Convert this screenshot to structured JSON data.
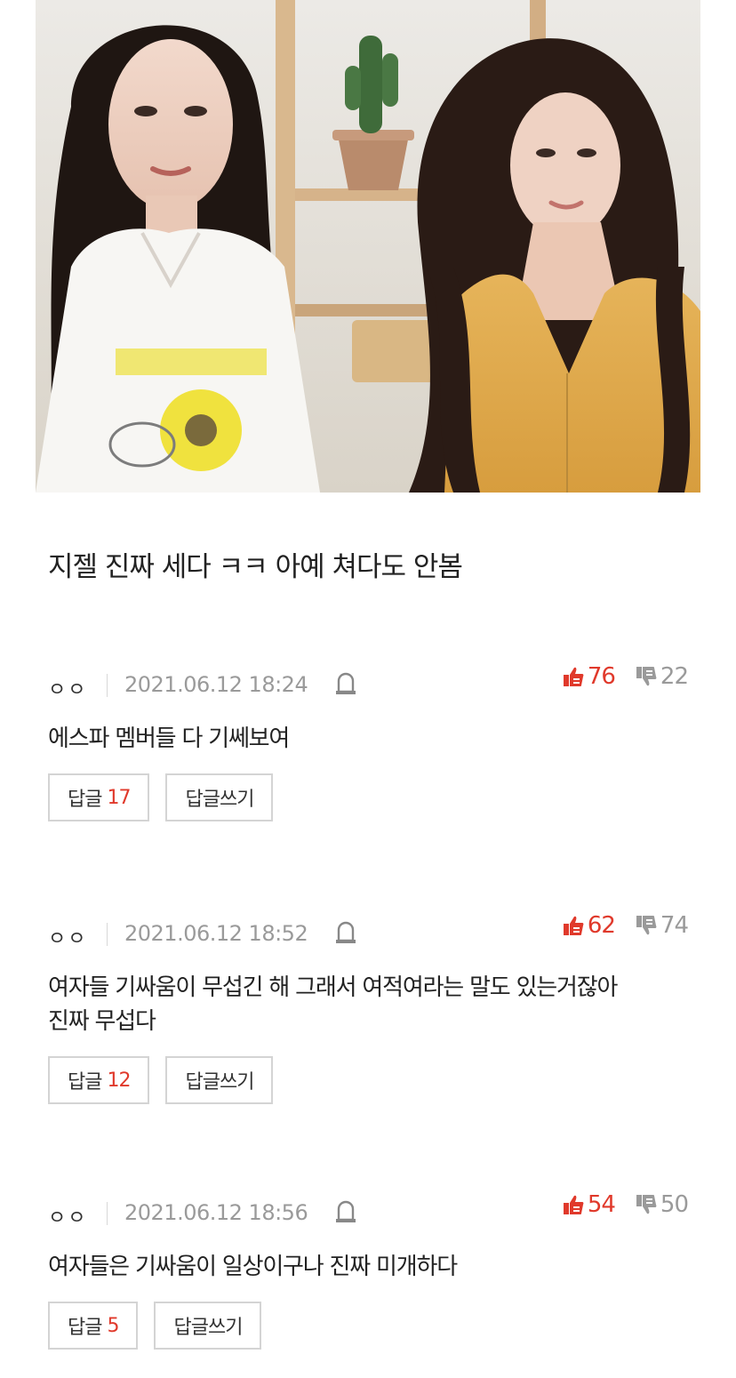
{
  "post": {
    "text": "지젤 진짜 세다 ㅋㅋ 아예 쳐다도 안봄"
  },
  "colors": {
    "accent_red": "#e0392b",
    "muted_gray": "#9a9a9a",
    "button_border": "#d4d4d4"
  },
  "icons": {
    "report": "bell-report-icon",
    "upvote": "thumbs-up-icon",
    "downvote": "thumbs-down-icon"
  },
  "comments": [
    {
      "author": "ㅇㅇ",
      "date": "2021.06.12 18:24",
      "upvotes": "76",
      "downvotes": "22",
      "body": "에스파 멤버들 다 기쎄보여",
      "reply_label": "답글",
      "reply_count": "17",
      "write_reply_label": "답글쓰기"
    },
    {
      "author": "ㅇㅇ",
      "date": "2021.06.12 18:52",
      "upvotes": "62",
      "downvotes": "74",
      "body": "여자들 기싸움이 무섭긴 해 그래서 여적여라는 말도 있는거잖아\n진짜 무섭다",
      "reply_label": "답글",
      "reply_count": "12",
      "write_reply_label": "답글쓰기"
    },
    {
      "author": "ㅇㅇ",
      "date": "2021.06.12 18:56",
      "upvotes": "54",
      "downvotes": "50",
      "body": "여자들은 기싸움이 일상이구나 진짜 미개하다",
      "reply_label": "답글",
      "reply_count": "5",
      "write_reply_label": "답글쓰기"
    }
  ]
}
